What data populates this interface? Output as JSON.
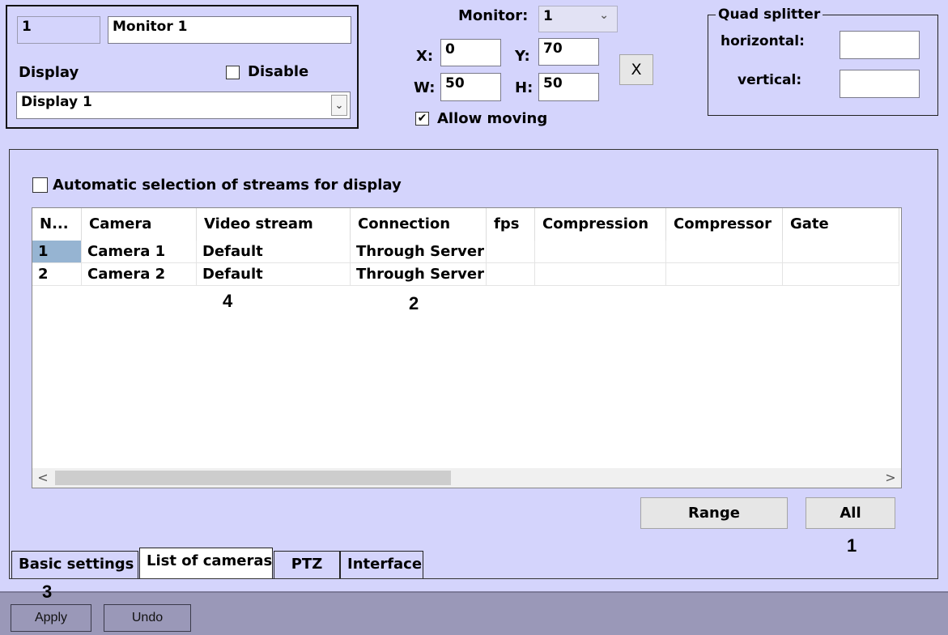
{
  "monitor_panel": {
    "id_value": "1",
    "name_value": "Monitor 1",
    "display_label": "Display",
    "disable_label": "Disable",
    "display_select": "Display 1"
  },
  "position": {
    "monitor_label": "Monitor:",
    "monitor_value": "1",
    "x_label": "X:",
    "x_value": "0",
    "y_label": "Y:",
    "y_value": "70",
    "w_label": "W:",
    "w_value": "50",
    "h_label": "H:",
    "h_value": "50",
    "clear_button": "X",
    "allow_moving_label": "Allow moving",
    "allow_moving_mark": "✔"
  },
  "quad_splitter": {
    "title": "Quad splitter",
    "horizontal_label": "horizontal:",
    "horizontal_value": "",
    "vertical_label": "vertical:",
    "vertical_value": ""
  },
  "cameras": {
    "auto_select_label": "Automatic selection of streams for display",
    "columns": [
      "N...",
      "Camera",
      "Video stream",
      "Connection",
      "fps",
      "Compression",
      "Compressor",
      "Gate"
    ],
    "rows": [
      [
        "1",
        "Camera 1",
        "Default",
        "Through Server",
        "",
        "",
        "",
        ""
      ],
      [
        "2",
        "Camera 2",
        "Default",
        "Through Server",
        "",
        "",
        "",
        ""
      ]
    ],
    "range_button": "Range",
    "all_button": "All"
  },
  "tabs": [
    "Basic settings",
    "List of cameras",
    "PTZ",
    "Interface"
  ],
  "bottom": {
    "apply_button": "Apply",
    "undo_button": "Undo"
  },
  "annotations": {
    "a1": "1",
    "a2": "2",
    "a3": "3",
    "a4": "4"
  },
  "icons": {
    "dropdown": "chevron-down-icon",
    "scroll_left": "scroll-left-icon",
    "scroll_right": "scroll-right-icon"
  }
}
